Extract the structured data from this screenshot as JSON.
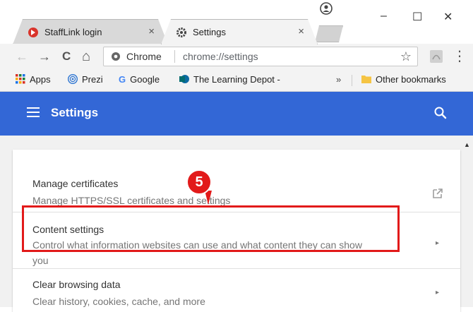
{
  "tabs": [
    {
      "title": "StaffLink login",
      "active": false,
      "close": "×"
    },
    {
      "title": "Settings",
      "active": true,
      "close": "×"
    }
  ],
  "window_controls": {
    "minimize": "–",
    "maximize": "☐",
    "close": "✕"
  },
  "toolbar": {
    "back": "←",
    "forward": "→",
    "reload": "C",
    "home": "⌂",
    "omnibox_chip": "Chrome",
    "url": "chrome://settings",
    "bookmark_star": "☆",
    "menu": "⋮"
  },
  "bookmarks": {
    "items": [
      "Apps",
      "Prezi",
      "Google",
      "The Learning Depot -"
    ],
    "overflow": "»",
    "other": "Other bookmarks"
  },
  "settings_header": {
    "title": "Settings"
  },
  "settings_rows": [
    {
      "title": "Manage certificates",
      "description": "Manage HTTPS/SSL certificates and settings",
      "action": "external-link"
    },
    {
      "title": "Content settings",
      "description_line1": "Control what information websites can use and what content they can show",
      "description_line2": "you",
      "action": "arrow",
      "arrow": "▸"
    },
    {
      "title": "Clear browsing data",
      "description": "Clear history, cookies, cache, and more",
      "action": "arrow",
      "arrow": "▸"
    }
  ],
  "annotation": {
    "step_number": "5"
  },
  "colors": {
    "header_blue": "#3367d6",
    "highlight_red": "#e21a1a"
  }
}
